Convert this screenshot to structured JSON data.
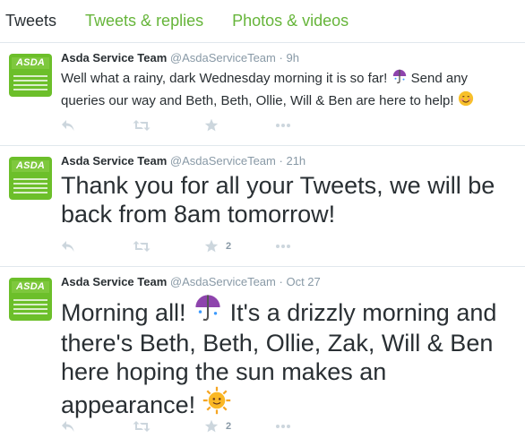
{
  "tabs": [
    "Tweets",
    "Tweets & replies",
    "Photos & videos"
  ],
  "colors": {
    "accent": "#66b53a",
    "muted": "#8899a6",
    "action": "#ccd6dd"
  },
  "icons": [
    "reply-icon",
    "retweet-icon",
    "favorite-icon",
    "more-icon",
    "umbrella-emoji",
    "smile-emoji",
    "sun-emoji"
  ],
  "avatar": {
    "logo": "ASDA"
  },
  "tweets": [
    {
      "name": "Asda Service Team",
      "handle": "@AsdaServiceTeam",
      "dot": "·",
      "time": "9h",
      "text_a": "Well what a rainy, dark Wednesday morning it is so far!",
      "text_b": "Send any queries our way and Beth, Beth, Ollie, Will & Ben are here to help!",
      "favorites": ""
    },
    {
      "name": "Asda Service Team",
      "handle": "@AsdaServiceTeam",
      "dot": "·",
      "time": "21h",
      "text_a": "Thank you for all your Tweets, we will be back from 8am tomorrow!",
      "favorites": "2"
    },
    {
      "name": "Asda Service Team",
      "handle": "@AsdaServiceTeam",
      "dot": "·",
      "time": "Oct 27",
      "text_a": "Morning all!",
      "text_b": "It's a drizzly morning and there's Beth, Beth, Ollie, Zak, Will & Ben here hoping the sun makes an appearance!",
      "favorites": "2"
    }
  ]
}
